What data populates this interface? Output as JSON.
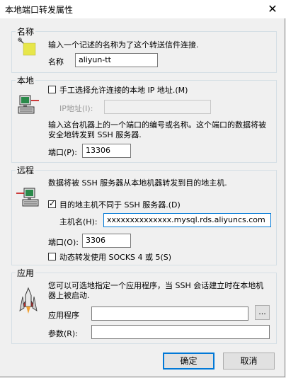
{
  "window": {
    "title": "本地端口转发属性",
    "close_glyph": "✕"
  },
  "name_section": {
    "label": "名称",
    "description": "输入一个记述的名称为了这个转送信件连接.",
    "name_label": "名称",
    "name_value": "aliyun-tt"
  },
  "local_section": {
    "label": "本地",
    "manual_ip_label": "手工选择允许连接的本地 IP 地址.(M)",
    "ip_address_label": "IP地址(I):",
    "ip_address_value": "",
    "description": "输入这台机器上的一个端口的编号或名称。这个端口的数据将被安全地转发到 SSH 服务器.",
    "port_label": "端口(P):",
    "port_value": "13306"
  },
  "remote_section": {
    "label": "远程",
    "description": "数据将被 SSH 服务器从本地机器转发到目的地主机.",
    "dest_host_differs_label": "目的地主机不同于 SSH 服务器.(D)",
    "hostname_label": "主机名(H):",
    "hostname_value": "xxxxxxxxxxxxxx.mysql.rds.aliyuncs.com",
    "port_label": "端口(O):",
    "port_value": "3306",
    "socks_label": "动态转发使用 SOCKS 4 或 5(S)"
  },
  "app_section": {
    "label": "应用",
    "description": "您可以可选地指定一个应用程序，当 SSH 会话建立时在本地机器上被启动.",
    "program_label": "应用程序",
    "program_value": "",
    "browse_label": "...",
    "args_label": "参数(R):",
    "args_value": ""
  },
  "buttons": {
    "ok": "确定",
    "cancel": "取消"
  },
  "state": {
    "manual_ip_checked": false,
    "dest_host_differs_checked": true,
    "socks_checked": false
  },
  "icons": [
    "tag-icon",
    "local-computer-icon",
    "remote-computer-icon",
    "rocket-icon"
  ],
  "colors": {
    "focus": "#0078d7",
    "section_border": "#d5dfe5"
  }
}
